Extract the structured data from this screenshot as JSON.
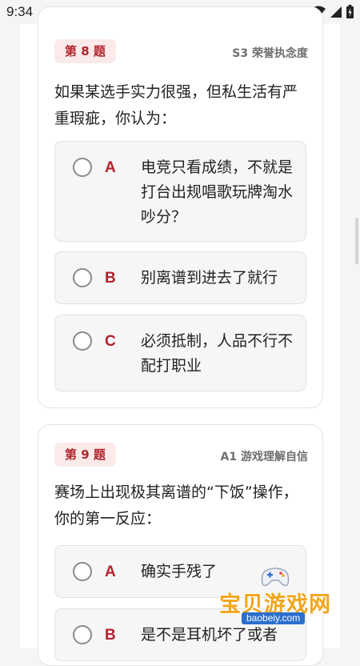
{
  "status_bar": {
    "time": "9:34",
    "app_icon_letter": "A"
  },
  "questions": [
    {
      "number_label": "第 8 题",
      "tag": "S3 荣誉执念度",
      "question_text": "如果某选手实力很强，但私生活有严重瑕疵，你认为：",
      "options": [
        {
          "letter": "A",
          "text": "电竞只看成绩，不就是打台出规唱歌玩牌淘水吵分？"
        },
        {
          "letter": "B",
          "text": "别离谱到进去了就行"
        },
        {
          "letter": "C",
          "text": "必须抵制，人品不行不配打职业"
        }
      ]
    },
    {
      "number_label": "第 9 题",
      "tag": "A1 游戏理解自信",
      "question_text": "赛场上出现极其离谱的“下饭”操作，你的第一反应：",
      "options": [
        {
          "letter": "A",
          "text": "确实手残了"
        },
        {
          "letter": "B",
          "text": "是不是耳机坏了或者"
        }
      ]
    }
  ],
  "watermark": {
    "text": "宝贝游戏网",
    "url": "baobeiy.com"
  },
  "colors": {
    "accent": "#b4222c",
    "badge_bg": "#fbeaea",
    "watermark_orange": "#f3a51b"
  }
}
